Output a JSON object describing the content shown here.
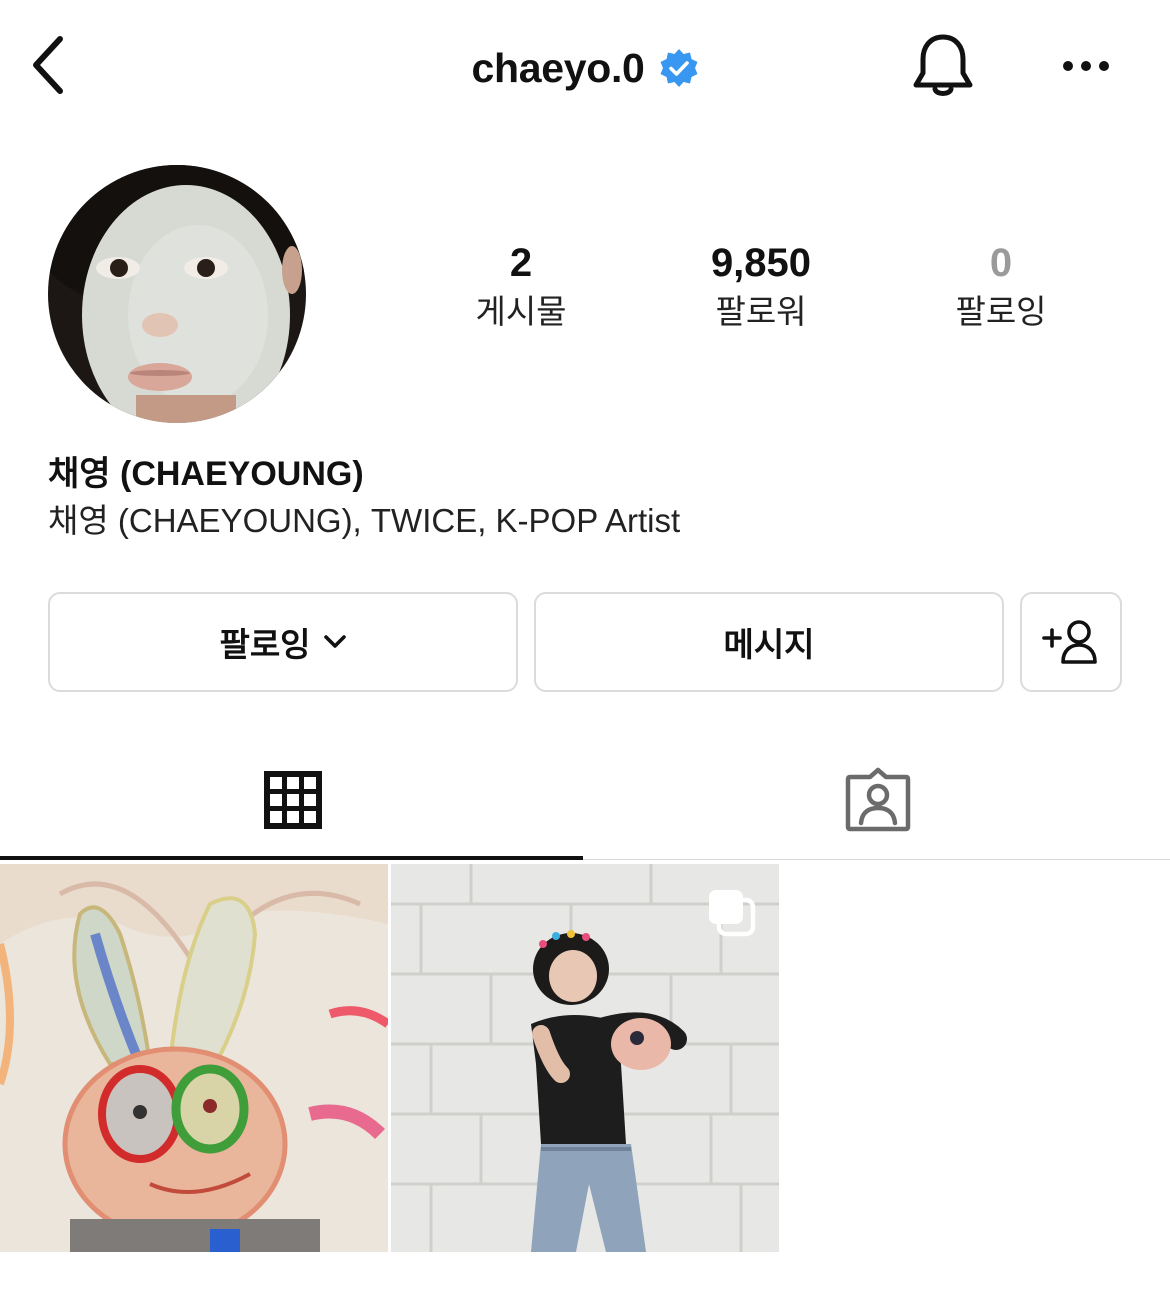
{
  "header": {
    "username": "chaeyo.0",
    "verified_color": "#3897f0"
  },
  "stats": {
    "posts": {
      "count": "2",
      "label": "게시물"
    },
    "followers": {
      "count": "9,850",
      "label": "팔로워"
    },
    "following": {
      "count": "0",
      "label": "팔로잉"
    }
  },
  "profile": {
    "display_name": "채영 (CHAEYOUNG)",
    "bio": "채영 (CHAEYOUNG), TWICE, K-POP Artist"
  },
  "actions": {
    "follow_label": "팔로잉",
    "message_label": "메시지"
  },
  "icons": {
    "back": "chevron-left-icon",
    "verified": "verified-badge-icon",
    "bell": "bell-icon",
    "more": "more-horizontal-icon",
    "chevron": "chevron-down-icon",
    "add_user": "add-user-icon",
    "grid": "grid-icon",
    "tagged": "tagged-person-icon",
    "multiple": "multiple-posts-icon"
  },
  "tabs": {
    "active": "grid"
  }
}
